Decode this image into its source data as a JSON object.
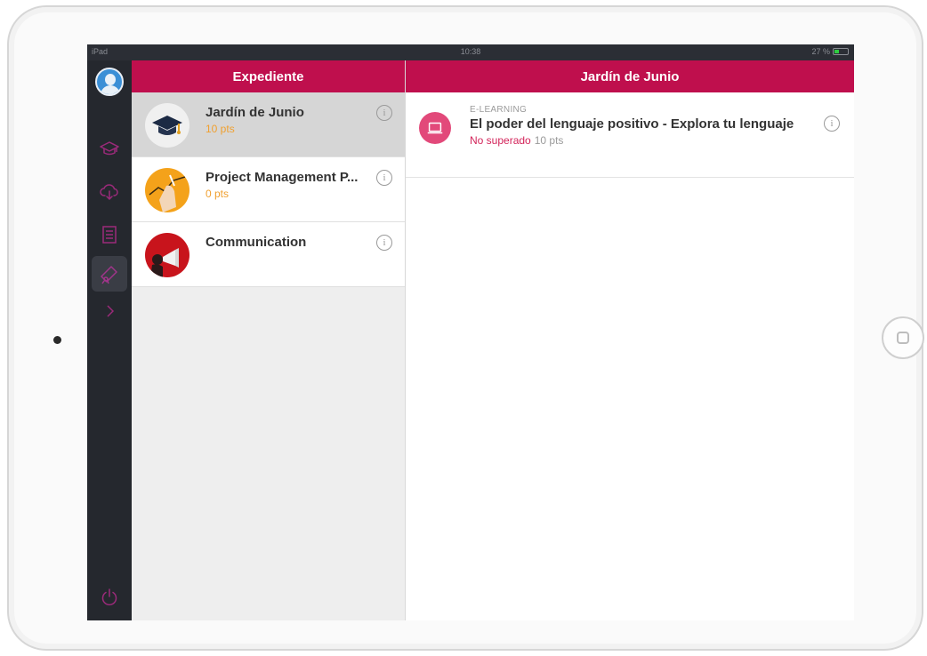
{
  "status_bar": {
    "device": "iPad",
    "time": "10:38",
    "battery": "27 %"
  },
  "left_panel": {
    "title": "Expediente",
    "courses": [
      {
        "title": "Jardín de Junio",
        "points": "10 pts",
        "selected": true
      },
      {
        "title": "Project Management P...",
        "points": "0 pts",
        "selected": false
      },
      {
        "title": "Communication",
        "points": "",
        "selected": false
      }
    ]
  },
  "right_panel": {
    "title": "Jardín de Junio",
    "activities": [
      {
        "type": "E-LEARNING",
        "title": "El poder del lenguaje positivo - Explora tu lenguaje",
        "status": "No superado",
        "points": "10 pts"
      }
    ]
  },
  "info_glyph": "i",
  "sidebar": {
    "icons": [
      "avatar",
      "graduation-cap-icon",
      "cloud-icon",
      "document-icon",
      "diploma-icon",
      "chevron-right-icon",
      "power-icon"
    ]
  },
  "colors": {
    "accent": "#bf0f4d",
    "sidebar_bg": "#25282e",
    "points_orange": "#f0a030",
    "status_red": "#d3245a",
    "icon_magenta": "#9b2a7a"
  }
}
